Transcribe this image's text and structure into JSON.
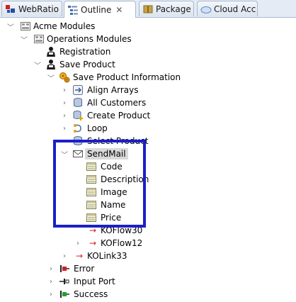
{
  "tabs": [
    {
      "label": "WebRatio E",
      "icon": "webratio-icon",
      "active": false
    },
    {
      "label": "Outline",
      "icon": "outline-icon",
      "active": true,
      "close": "✕"
    },
    {
      "label": "Package E",
      "icon": "package-explorer-icon",
      "active": false
    },
    {
      "label": "Cloud Acc",
      "icon": "cloud-icon",
      "active": false
    }
  ],
  "tree": {
    "acme_modules": "Acme Modules",
    "operations_modules": "Operations Modules",
    "registration": "Registration",
    "save_product": "Save Product",
    "save_product_information": "Save Product Information",
    "align_arrays": "Align Arrays",
    "all_customers": "All Customers",
    "create_product": "Create Product",
    "loop": "Loop",
    "select_product": "Select Product",
    "sendmail": "SendMail",
    "fields": [
      "Code",
      "Description",
      "Image",
      "Name",
      "Price"
    ],
    "koflow30": "KOFlow30",
    "koflow12": "KOFlow12",
    "kolink33": "KOLink33",
    "error": "Error",
    "input_port": "Input Port",
    "success": "Success"
  },
  "colors": {
    "highlight": "#1a20c8",
    "selection": "#d9d9d9",
    "ko_arrow": "#d42020"
  }
}
